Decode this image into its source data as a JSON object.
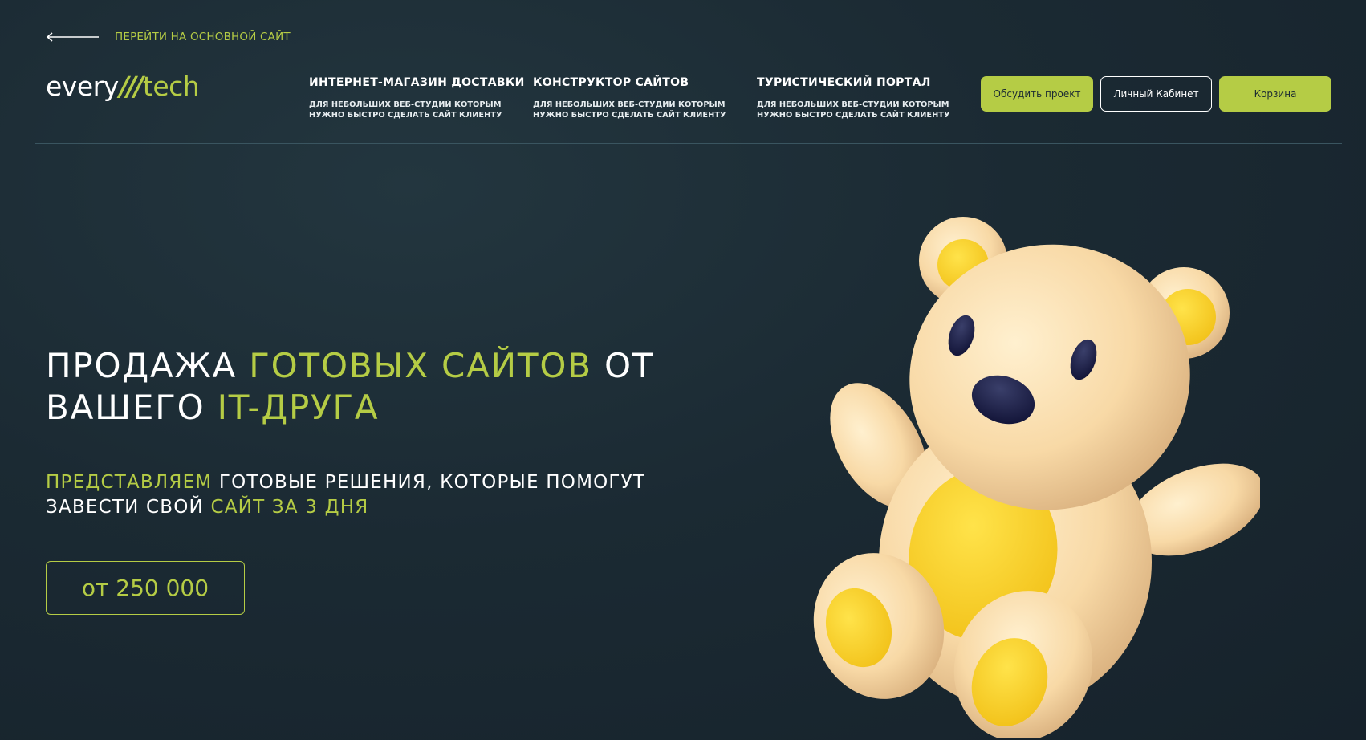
{
  "back_link": {
    "label": "ПЕРЕЙТИ НА ОСНОВНОЙ САЙТ",
    "icon": "arrow-left-icon"
  },
  "logo": {
    "part1": "every",
    "slash": "///",
    "part2": "tech"
  },
  "nav": [
    {
      "title": "ИНТЕРНЕТ-МАГАЗИН ДОСТАВКИ",
      "description": "ДЛЯ НЕБОЛЬШИХ ВЕБ-СТУДИЙ КОТОРЫМ НУЖНО БЫСТРО СДЕЛАТЬ САЙТ КЛИЕНТУ"
    },
    {
      "title": "КОНСТРУКТОР САЙТОВ",
      "description": "ДЛЯ НЕБОЛЬШИХ ВЕБ-СТУДИЙ КОТОРЫМ НУЖНО БЫСТРО СДЕЛАТЬ САЙТ КЛИЕНТУ"
    },
    {
      "title": "ТУРИСТИЧЕСКИЙ ПОРТАЛ",
      "description": "ДЛЯ НЕБОЛЬШИХ ВЕБ-СТУДИЙ КОТОРЫМ НУЖНО БЫСТРО СДЕЛАТЬ САЙТ КЛИЕНТУ"
    }
  ],
  "buttons": {
    "discuss": "Обсудить проект",
    "cabinet": "Личный Кабинет",
    "cart": "Корзина"
  },
  "hero": {
    "title_1": "ПРОДАЖА ",
    "title_2": "ГОТОВЫХ САЙТОВ",
    "title_3": " ОТ ВАШЕГО ",
    "title_4": "IT-ДРУГА",
    "sub_1": "ПРЕДСТАВЛЯЕМ",
    "sub_2": " ГОТОВЫЕ РЕШЕНИЯ, КОТОРЫЕ ПОМОГУТ ЗАВЕСТИ СВОЙ ",
    "sub_3": "САЙТ ЗА 3 ДНЯ",
    "price": "от 250 000"
  },
  "colors": {
    "accent": "#b5cc45",
    "background": "#1b2a33",
    "text": "#ffffff"
  },
  "illustration": {
    "icon": "teddy-bear-3d-illustration"
  }
}
